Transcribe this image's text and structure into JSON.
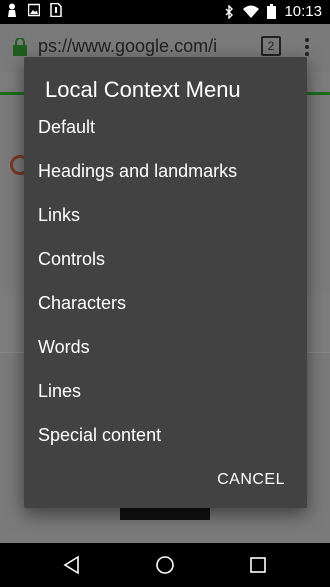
{
  "status_bar": {
    "time": "10:13",
    "left_icons": [
      "person-icon",
      "image-icon",
      "sim-icon"
    ],
    "right_icons": [
      "bluetooth-icon",
      "wifi-icon",
      "battery-icon"
    ]
  },
  "browser": {
    "url": "ps://www.google.com/i",
    "tab_count": "2"
  },
  "dialog": {
    "title": "Local Context Menu",
    "items": [
      "Default",
      "Headings and landmarks",
      "Links",
      "Controls",
      "Characters",
      "Words",
      "Lines",
      "Special content"
    ],
    "cancel_label": "CANCEL"
  },
  "nav_bar": {
    "buttons": [
      "back-icon",
      "home-icon",
      "recents-icon"
    ]
  }
}
